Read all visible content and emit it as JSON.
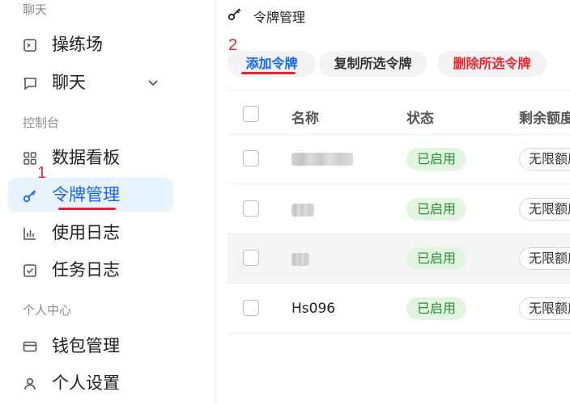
{
  "sidebar": {
    "sections": [
      {
        "label": "聊天"
      },
      {
        "label": "控制台"
      },
      {
        "label": "个人中心"
      }
    ],
    "items": [
      {
        "label": "操练场",
        "icon": "terminal-icon"
      },
      {
        "label": "聊天",
        "icon": "chat-icon"
      },
      {
        "label": "数据看板",
        "icon": "dashboard-icon"
      },
      {
        "label": "令牌管理",
        "icon": "key-icon",
        "active": true
      },
      {
        "label": "使用日志",
        "icon": "bar-chart-icon"
      },
      {
        "label": "任务日志",
        "icon": "checkbox-icon"
      },
      {
        "label": "钱包管理",
        "icon": "wallet-icon"
      },
      {
        "label": "个人设置",
        "icon": "user-icon"
      }
    ]
  },
  "header": {
    "title": "令牌管理",
    "icon": "key-icon"
  },
  "toolbar": {
    "add_label": "添加令牌",
    "copy_label": "复制所选令牌",
    "delete_label": "删除所选令牌"
  },
  "table": {
    "columns": [
      "名称",
      "状态",
      "剩余额度"
    ],
    "rows": [
      {
        "name": "",
        "name_blurred": true,
        "status": "已启用",
        "quota": "无限额度"
      },
      {
        "name": "",
        "name_blurred": true,
        "status": "已启用",
        "quota": "无限额度"
      },
      {
        "name": "",
        "name_blurred": true,
        "status": "已启用",
        "quota": "无限额度"
      },
      {
        "name": "Hs096",
        "name_blurred": false,
        "status": "已启用",
        "quota": "无限额度"
      }
    ]
  },
  "annotations": {
    "step1": "1",
    "step2": "2"
  },
  "colors": {
    "accent": "#1664ff",
    "active_bg": "#e8f3ff",
    "danger": "#f5222d",
    "status_bg": "#e3f5e1",
    "status_text": "#2a8a3a",
    "annotation": "#e8242f"
  }
}
